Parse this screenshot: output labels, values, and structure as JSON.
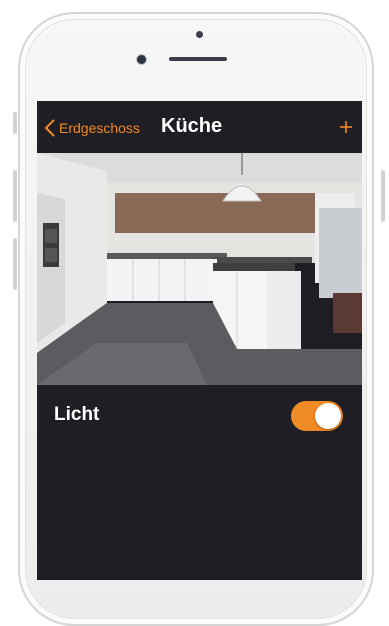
{
  "navbar": {
    "back_label": "Erdgeschoss",
    "title": "Küche",
    "accent_color": "#f08a24",
    "back_icon": "chevron-left-icon",
    "add_icon": "plus-icon"
  },
  "room_image": {
    "subject": "kitchen"
  },
  "controls": [
    {
      "label": "Licht",
      "state": true
    }
  ],
  "colors": {
    "screen_background": "#1f1e24",
    "toggle_on": "#f08a24",
    "text": "#ffffff"
  }
}
